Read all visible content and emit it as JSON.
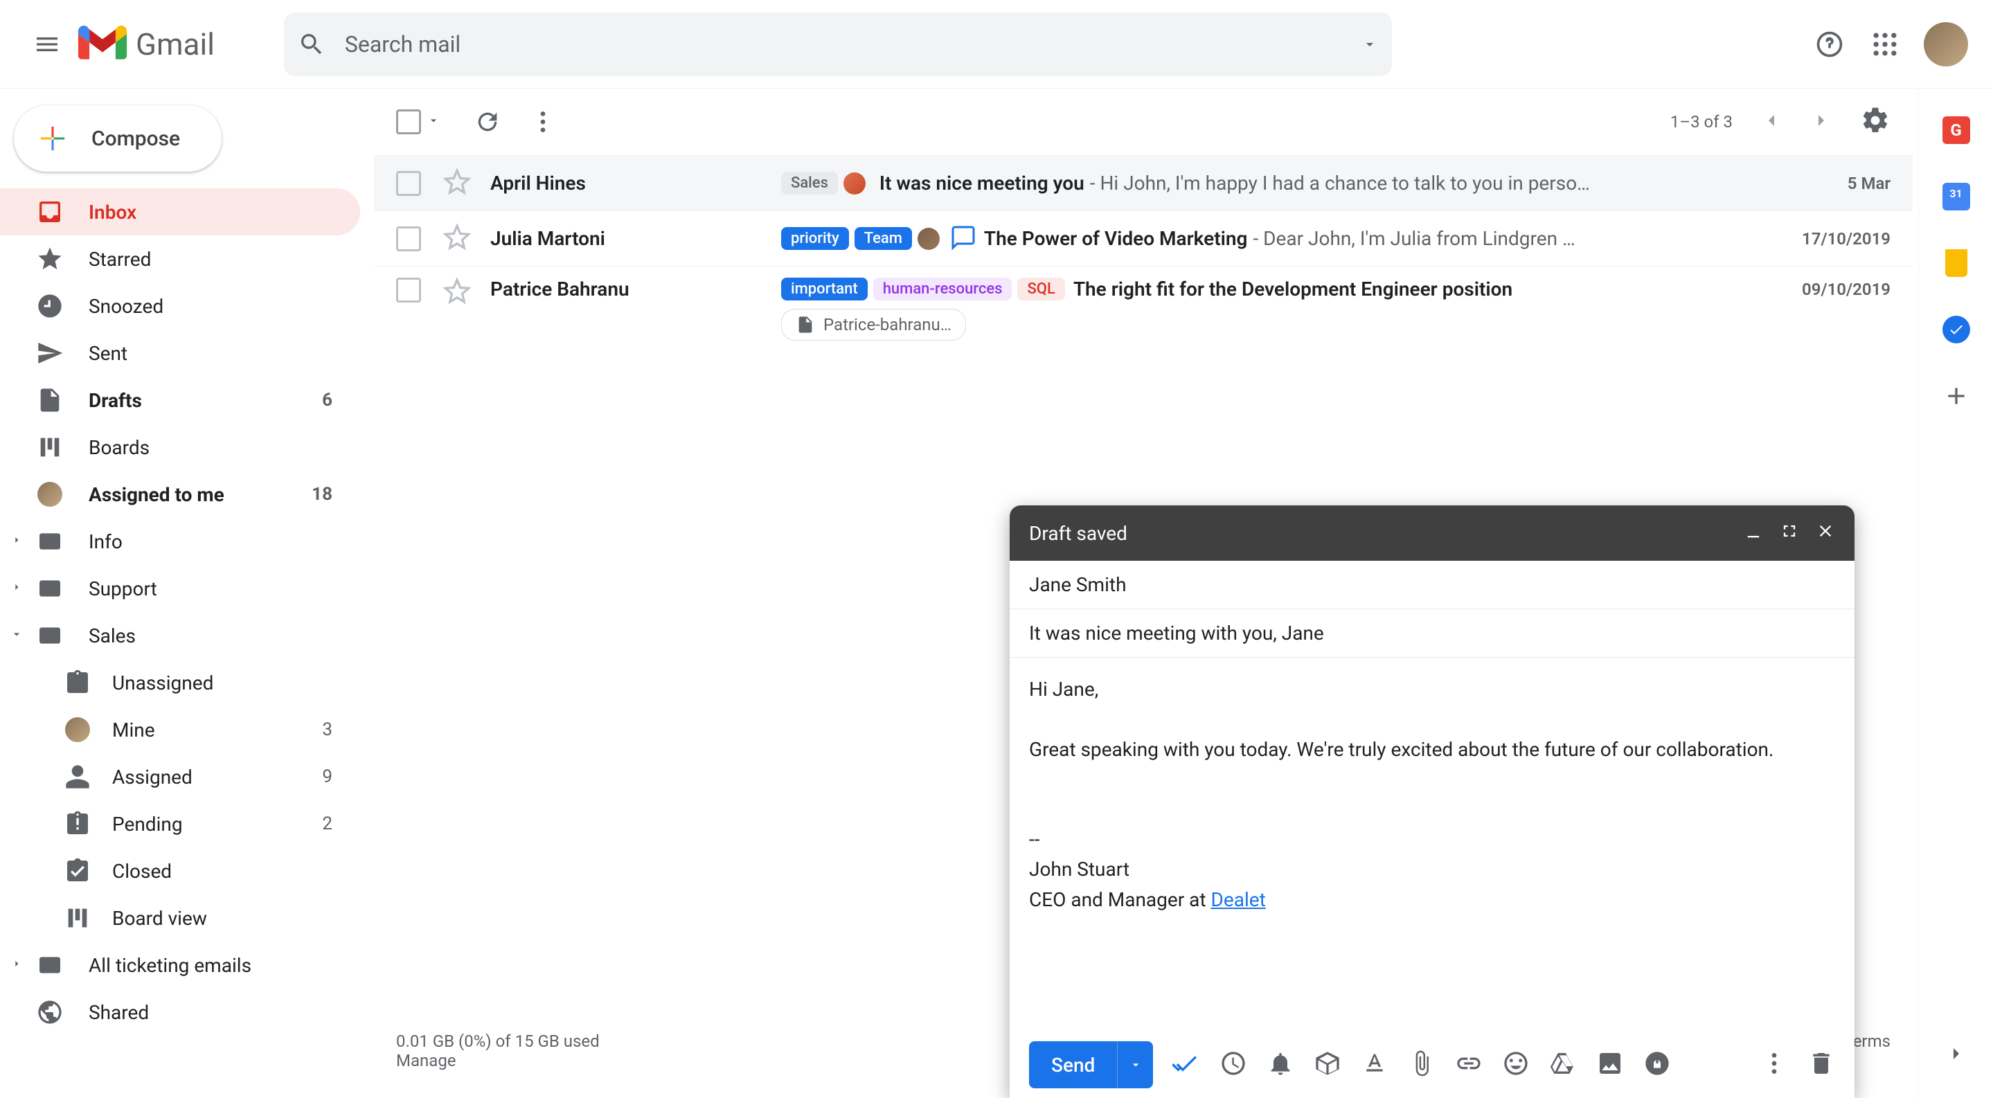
{
  "header": {
    "logo_text": "Gmail",
    "search_placeholder": "Search mail"
  },
  "sidebar": {
    "compose_label": "Compose",
    "items": [
      {
        "label": "Inbox",
        "count": ""
      },
      {
        "label": "Starred",
        "count": ""
      },
      {
        "label": "Snoozed",
        "count": ""
      },
      {
        "label": "Sent",
        "count": ""
      },
      {
        "label": "Drafts",
        "count": "6"
      },
      {
        "label": "Boards",
        "count": ""
      },
      {
        "label": "Assigned to me",
        "count": "18"
      },
      {
        "label": "Info",
        "count": ""
      },
      {
        "label": "Support",
        "count": ""
      },
      {
        "label": "Sales",
        "count": ""
      }
    ],
    "sales_sub": [
      {
        "label": "Unassigned",
        "count": ""
      },
      {
        "label": "Mine",
        "count": "3"
      },
      {
        "label": "Assigned",
        "count": "9"
      },
      {
        "label": "Pending",
        "count": "2"
      },
      {
        "label": "Closed",
        "count": ""
      },
      {
        "label": "Board view",
        "count": ""
      }
    ],
    "bottom": [
      {
        "label": "All ticketing emails"
      },
      {
        "label": "Shared"
      }
    ]
  },
  "toolbar": {
    "count_text": "1–3 of 3"
  },
  "emails": [
    {
      "sender": "April Hines",
      "tags": [
        {
          "text": "Sales",
          "cls": "sales"
        }
      ],
      "subject": "It was nice meeting you",
      "preview": " - Hi John, I'm happy I had a chance to talk to you in perso…",
      "date": "5 Mar"
    },
    {
      "sender": "Julia Martoni",
      "tags": [
        {
          "text": "priority",
          "cls": "priority"
        },
        {
          "text": "Team",
          "cls": "team"
        }
      ],
      "subject": "The Power of Video Marketing",
      "preview": " - Dear John, I'm Julia from Lindgren …",
      "date": "17/10/2019"
    },
    {
      "sender": "Patrice Bahranu",
      "tags": [
        {
          "text": "important",
          "cls": "important"
        },
        {
          "text": "human-resources",
          "cls": "hr"
        },
        {
          "text": "SQL",
          "cls": "sql"
        }
      ],
      "subject": "The right fit for the Development Engineer position",
      "preview": "",
      "date": "09/10/2019",
      "attachment": "Patrice-bahranu…"
    }
  ],
  "footer": {
    "storage": "0.01 GB (0%) of 15 GB used",
    "manage": "Manage",
    "terms": "Terms"
  },
  "compose": {
    "header_title": "Draft saved",
    "to": "Jane Smith",
    "subject": "It was nice meeting with you, Jane",
    "body_greeting": "Hi Jane,",
    "body_main": "Great speaking with you today. We're truly excited about the future of our collaboration.",
    "sig_sep": "--",
    "sig_name": "John Stuart",
    "sig_title_prefix": "CEO and Manager at ",
    "sig_link": "Dealet",
    "send_label": "Send"
  }
}
